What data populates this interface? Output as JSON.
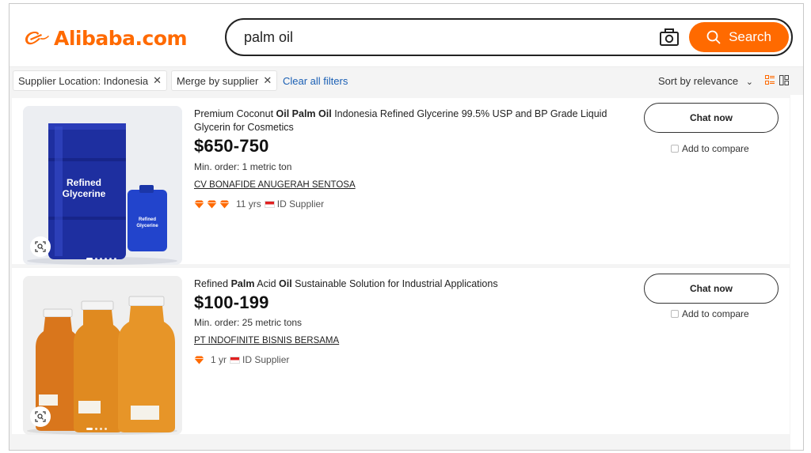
{
  "header": {
    "logo_text": "Alibaba.com",
    "search": {
      "value": "palm oil",
      "button_label": "Search"
    }
  },
  "filters": {
    "chips": [
      {
        "label": "Supplier Location: Indonesia",
        "remove": "✕"
      },
      {
        "label": "Merge by supplier",
        "remove": "✕"
      }
    ],
    "clear_label": "Clear all filters",
    "sort_label": "Sort by relevance",
    "sort_chevron": "⌄"
  },
  "colors": {
    "brand": "#ff6a00",
    "link": "#1a5fb4"
  },
  "products": [
    {
      "title_parts": [
        {
          "text": "Premium Coconut ",
          "bold": false
        },
        {
          "text": "Oil",
          "bold": true
        },
        {
          "text": " ",
          "bold": false
        },
        {
          "text": "Palm",
          "bold": true
        },
        {
          "text": " ",
          "bold": false
        },
        {
          "text": "Oil",
          "bold": true
        },
        {
          "text": " Indonesia Refined Glycerine 99.5% USP and BP Grade Liquid Glycerin for Cosmetics",
          "bold": false
        }
      ],
      "price": "$650-750",
      "moq": "Min. order: 1 metric ton",
      "supplier": "CV BONAFIDE ANUGERAH SENTOSA",
      "diamonds": 3,
      "years": "11 yrs",
      "supplier_type": "ID Supplier",
      "chat_label": "Chat now",
      "compare_label": "Add to compare",
      "image_labels": {
        "drum": [
          "Refined",
          "Glycerine"
        ],
        "jerrycan": [
          "Refined",
          "Glycerine"
        ]
      }
    },
    {
      "title_parts": [
        {
          "text": "Refined ",
          "bold": false
        },
        {
          "text": "Palm",
          "bold": true
        },
        {
          "text": " Acid ",
          "bold": false
        },
        {
          "text": "Oil",
          "bold": true
        },
        {
          "text": " Sustainable Solution for Industrial Applications",
          "bold": false
        }
      ],
      "price": "$100-199",
      "moq": "Min. order: 25 metric tons",
      "supplier": "PT INDOFINITE BISNIS BERSAMA",
      "diamonds": 1,
      "years": "1 yr",
      "supplier_type": "ID Supplier",
      "chat_label": "Chat now",
      "compare_label": "Add to compare"
    }
  ]
}
